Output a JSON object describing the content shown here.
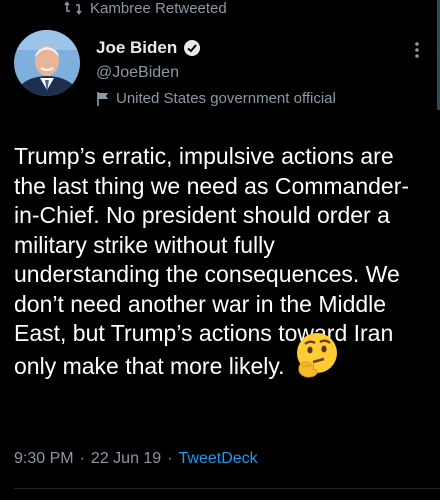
{
  "retweet": {
    "icon": "retweet-icon",
    "text": "Kambree Retweeted"
  },
  "author": {
    "avatar_icon": "avatar",
    "display_name": "Joe Biden",
    "verified_icon": "verified-badge-icon",
    "handle": "@JoeBiden",
    "label_icon": "flag-icon",
    "label_text": "United States government official"
  },
  "menu": {
    "icon": "more-options-icon"
  },
  "tweet": {
    "text": "Trump’s erratic, impulsive actions are the last thing we need as Commander-in-Chief. No president should order a military strike without fully understanding the consequences. We don’t need another war in the Middle East, but Trump’s actions toward Iran only make that more likely.",
    "emoji": "thinking-face-icon"
  },
  "meta": {
    "time": "9:30 PM",
    "separator1": "·",
    "date": "22 Jun 19",
    "separator2": "·",
    "source": "TweetDeck"
  },
  "colors": {
    "background": "#000000",
    "text_primary": "#e7e9ea",
    "text_secondary": "#8b98a5",
    "accent": "#1d9bf0"
  }
}
